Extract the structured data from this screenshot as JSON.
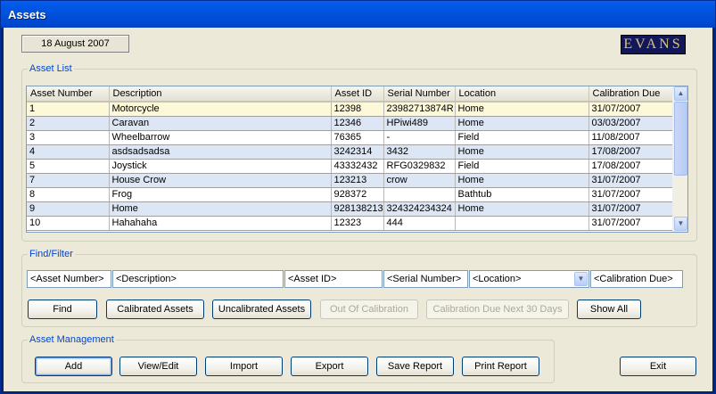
{
  "window": {
    "title": "Assets"
  },
  "header": {
    "date": "18 August 2007",
    "logo_text": "EVANS"
  },
  "asset_list": {
    "legend": "Asset List",
    "columns": [
      "Asset Number",
      "Description",
      "Asset ID",
      "Serial Number",
      "Location",
      "Calibration Due"
    ],
    "rows": [
      [
        "1",
        "Motorcycle",
        "12398",
        "23982713874R",
        "Home",
        "31/07/2007"
      ],
      [
        "2",
        "Caravan",
        "12346",
        "HPiwi489",
        "Home",
        "03/03/2007"
      ],
      [
        "3",
        "Wheelbarrow",
        "76365",
        "-",
        "Field",
        "11/08/2007"
      ],
      [
        "4",
        "asdsadsadsa",
        "3242314",
        "3432",
        "Home",
        "17/08/2007"
      ],
      [
        "5",
        "Joystick",
        "43332432",
        "RFG0329832",
        "Field",
        "17/08/2007"
      ],
      [
        "7",
        "House Crow",
        "123213",
        "crow",
        "Home",
        "31/07/2007"
      ],
      [
        "8",
        "Frog",
        "928372",
        "",
        "Bathtub",
        "31/07/2007"
      ],
      [
        "9",
        "Home",
        "928138213",
        "324324234324",
        "Home",
        "31/07/2007"
      ],
      [
        "10",
        "Hahahaha",
        "12323",
        "444",
        "",
        "31/07/2007"
      ]
    ]
  },
  "find_filter": {
    "legend": "Find/Filter",
    "asset_number_placeholder": "<Asset Number>",
    "description_placeholder": "<Description>",
    "asset_id_placeholder": "<Asset ID>",
    "serial_number_placeholder": "<Serial Number>",
    "location_value": "<Location>",
    "calibration_due_placeholder": "<Calibration Due>",
    "buttons": {
      "find": "Find",
      "calibrated": "Calibrated Assets",
      "uncalibrated": "Uncalibrated Assets",
      "out_of_calibration": "Out Of Calibration",
      "due_next_30": "Calibration Due Next 30 Days",
      "show_all": "Show All"
    }
  },
  "asset_management": {
    "legend": "Asset Management",
    "buttons": {
      "add": "Add",
      "view_edit": "View/Edit",
      "import": "Import",
      "export": "Export",
      "save_report": "Save Report",
      "print_report": "Print Report"
    }
  },
  "exit_label": "Exit"
}
